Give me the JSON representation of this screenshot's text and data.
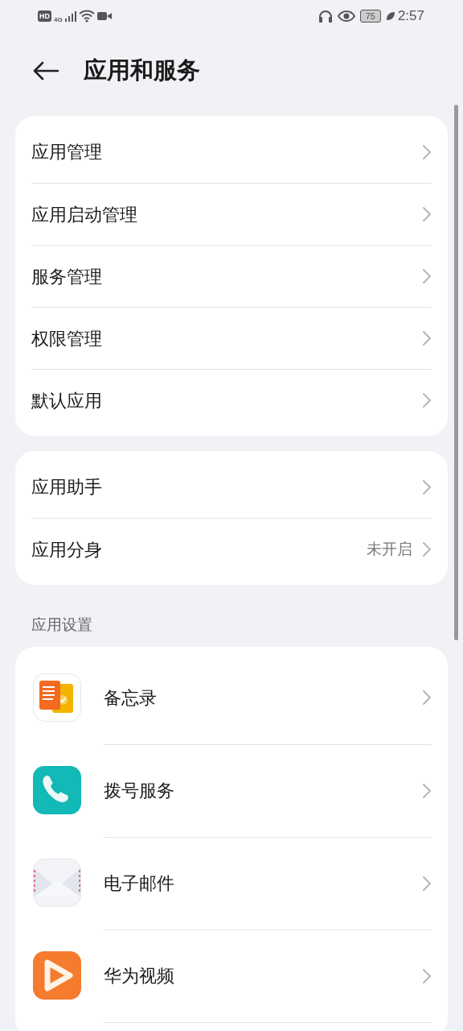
{
  "status_bar": {
    "hd": "HD",
    "network": "4G",
    "battery": "75",
    "time": "2:57"
  },
  "header": {
    "title": "应用和服务"
  },
  "groups": [
    {
      "items": [
        {
          "label": "应用管理"
        },
        {
          "label": "应用启动管理"
        },
        {
          "label": "服务管理"
        },
        {
          "label": "权限管理"
        },
        {
          "label": "默认应用"
        }
      ]
    },
    {
      "items": [
        {
          "label": "应用助手"
        },
        {
          "label": "应用分身",
          "value": "未开启"
        }
      ]
    }
  ],
  "app_settings": {
    "title": "应用设置",
    "apps": [
      {
        "kind": "memo",
        "label": "备忘录"
      },
      {
        "kind": "dialer",
        "label": "拨号服务"
      },
      {
        "kind": "email",
        "label": "电子邮件"
      },
      {
        "kind": "video",
        "label": "华为视频"
      }
    ]
  }
}
